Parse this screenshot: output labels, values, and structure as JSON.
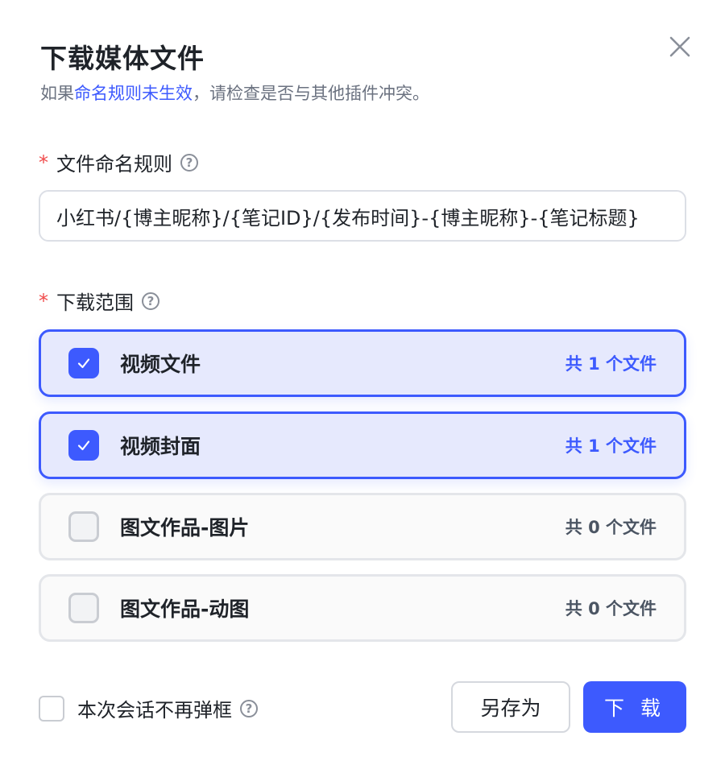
{
  "dialog": {
    "title": "下载媒体文件",
    "subtitle_prefix": "如果",
    "subtitle_link": "命名规则未生效",
    "subtitle_suffix": "，请检查是否与其他插件冲突。"
  },
  "naming": {
    "required_mark": "*",
    "label": "文件命名规则",
    "help": "?",
    "value": "小红书/{博主昵称}/{笔记ID}/{发布时间}-{博主昵称}-{笔记标题}"
  },
  "range": {
    "required_mark": "*",
    "label": "下载范围",
    "help": "?",
    "options": [
      {
        "label": "视频文件",
        "count": "共 1 个文件",
        "checked": true
      },
      {
        "label": "视频封面",
        "count": "共 1 个文件",
        "checked": true
      },
      {
        "label": "图文作品-图片",
        "count": "共 0 个文件",
        "checked": false
      },
      {
        "label": "图文作品-动图",
        "count": "共 0 个文件",
        "checked": false
      }
    ]
  },
  "footer": {
    "no_popup_label": "本次会话不再弹框",
    "help": "?",
    "save_as_label": "另存为",
    "download_label": "下 载"
  },
  "colors": {
    "accent": "#3d5afe",
    "required": "#f04b4b"
  }
}
